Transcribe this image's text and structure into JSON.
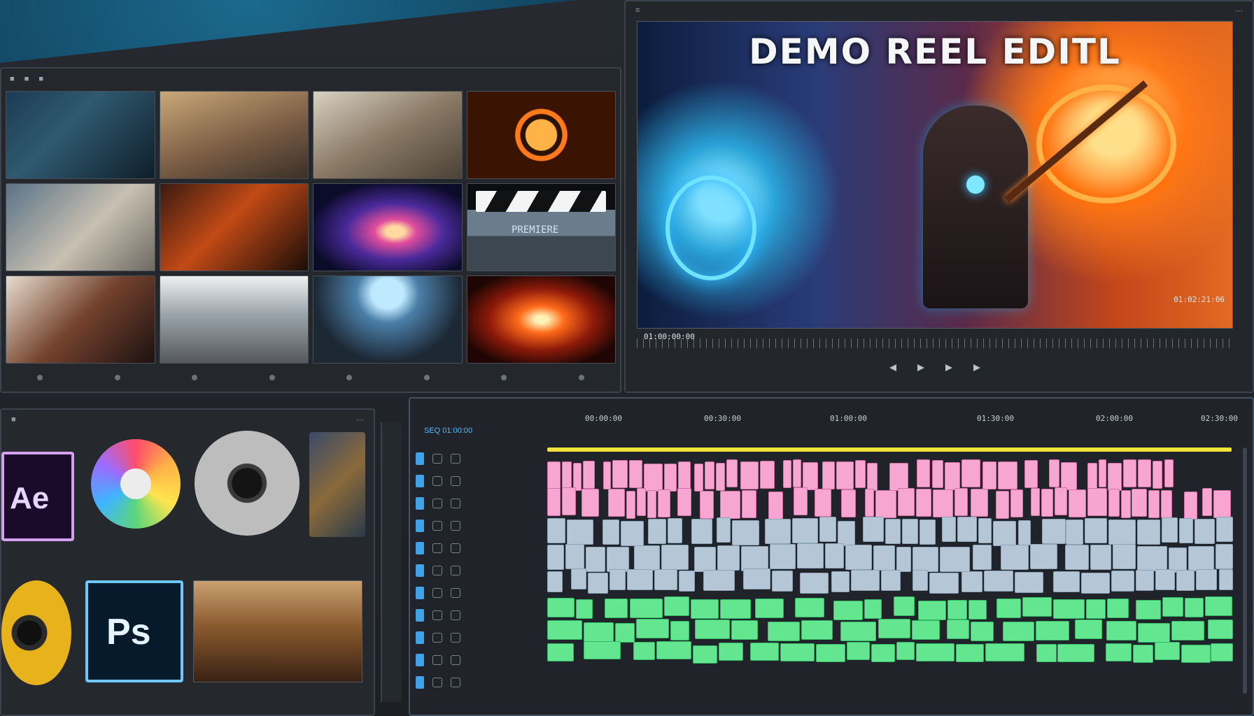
{
  "program_monitor": {
    "title": "DEMO REEL EDITL",
    "timecode_left": "01:00:00:00",
    "timecode_right": "01:02:21:06"
  },
  "media_bin": {
    "thumbnails": [
      {
        "label": ""
      },
      {
        "label": ""
      },
      {
        "label": ""
      },
      {
        "label": ""
      },
      {
        "label": ""
      },
      {
        "label": ""
      },
      {
        "label": ""
      },
      {
        "label": "PREMIERE"
      },
      {
        "label": ""
      },
      {
        "label": ""
      },
      {
        "label": ""
      },
      {
        "label": ""
      }
    ]
  },
  "project_panel": {
    "apps": [
      {
        "name": "After Effects",
        "glyph": "Ae"
      },
      {
        "name": "Photoshop",
        "glyph": "Ps"
      }
    ]
  },
  "timeline": {
    "sequence_label": "SEQ 01:00:00",
    "ruler": [
      "00:00:00",
      "00:30:00",
      "01:00:00",
      "01:30:00",
      "02:00:00",
      "02:30:00"
    ],
    "colors": {
      "video_top": "#f7a6d1",
      "video": "#b5c6d6",
      "audio": "#63e68f",
      "playhead": "#f2e33a"
    }
  }
}
